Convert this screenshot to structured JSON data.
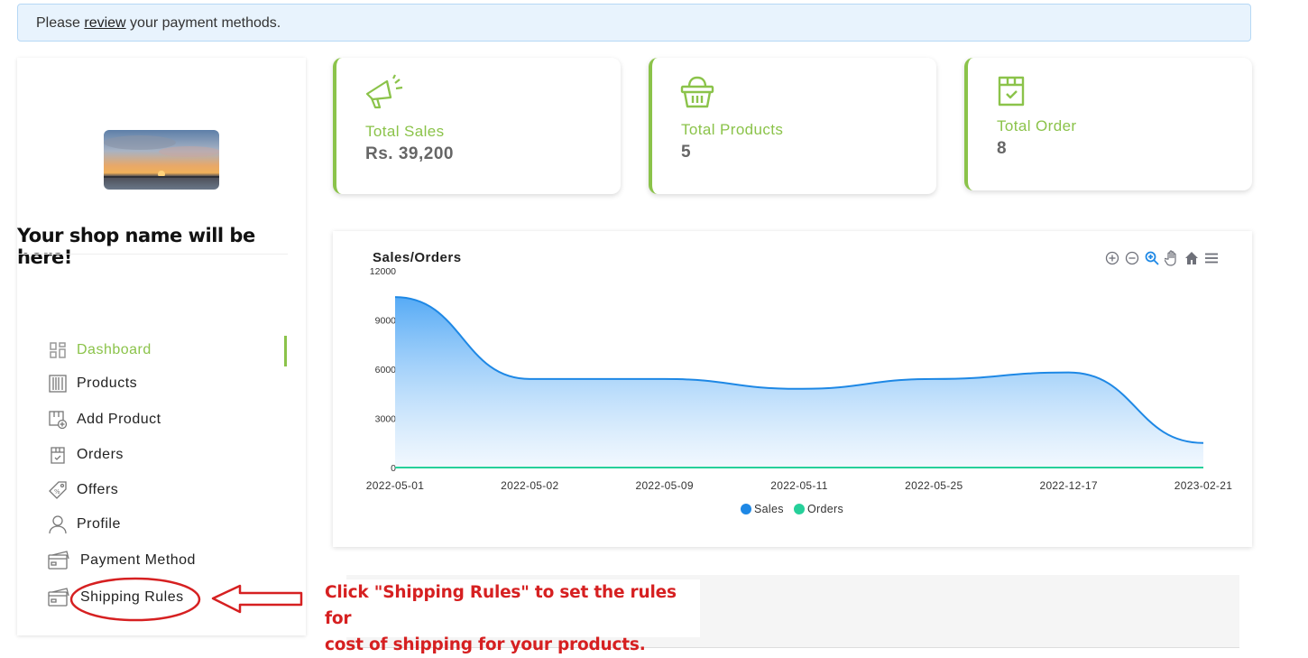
{
  "alert": {
    "prefix": "Please ",
    "link": "review",
    "suffix": " your payment methods."
  },
  "shop": {
    "name": "Your shop name will be here!"
  },
  "nav": [
    {
      "label": "Dashboard",
      "icon": "grid-icon",
      "active": true
    },
    {
      "label": "Products",
      "icon": "barcode-icon"
    },
    {
      "label": "Add Product",
      "icon": "add-box-icon"
    },
    {
      "label": "Orders",
      "icon": "box-check-icon"
    },
    {
      "label": "Offers",
      "icon": "tag-icon"
    },
    {
      "label": "Profile",
      "icon": "user-icon"
    },
    {
      "label": "Payment Method",
      "icon": "card-icon"
    },
    {
      "label": "Shipping Rules",
      "icon": "card-icon"
    }
  ],
  "cards": [
    {
      "label": "Total Sales",
      "value": "Rs. 39,200",
      "icon": "megaphone-icon"
    },
    {
      "label": "Total Products",
      "value": "5",
      "icon": "basket-icon"
    },
    {
      "label": "Total Order",
      "value": "8",
      "icon": "box-check-icon"
    }
  ],
  "tip": {
    "line1": "Click \"Shipping Rules\" to set the rules for",
    "line2": "cost of shipping for your products."
  },
  "colors": {
    "accent": "#8bc34a",
    "sales": "#1e88e5",
    "orders": "#26d09a",
    "annotation": "#d62021"
  },
  "chart_data": {
    "type": "area",
    "title": "Sales/Orders",
    "categories": [
      "2022-05-01",
      "2022-05-02",
      "2022-05-09",
      "2022-05-11",
      "2022-05-25",
      "2022-12-17",
      "2023-02-21"
    ],
    "series": [
      {
        "name": "Sales",
        "values": [
          10400,
          5400,
          5400,
          4800,
          5400,
          5800,
          1500
        ]
      },
      {
        "name": "Orders",
        "values": [
          1,
          1,
          1,
          1,
          2,
          1,
          1
        ]
      }
    ],
    "yticks": [
      "0",
      "3000",
      "6000",
      "9000",
      "12000"
    ],
    "ylim": [
      0,
      12000
    ],
    "legend": "bottom-center",
    "toolbar": [
      "zoom-in-icon",
      "zoom-out-icon",
      "magnify-icon",
      "pan-icon",
      "home-icon",
      "menu-icon"
    ]
  }
}
